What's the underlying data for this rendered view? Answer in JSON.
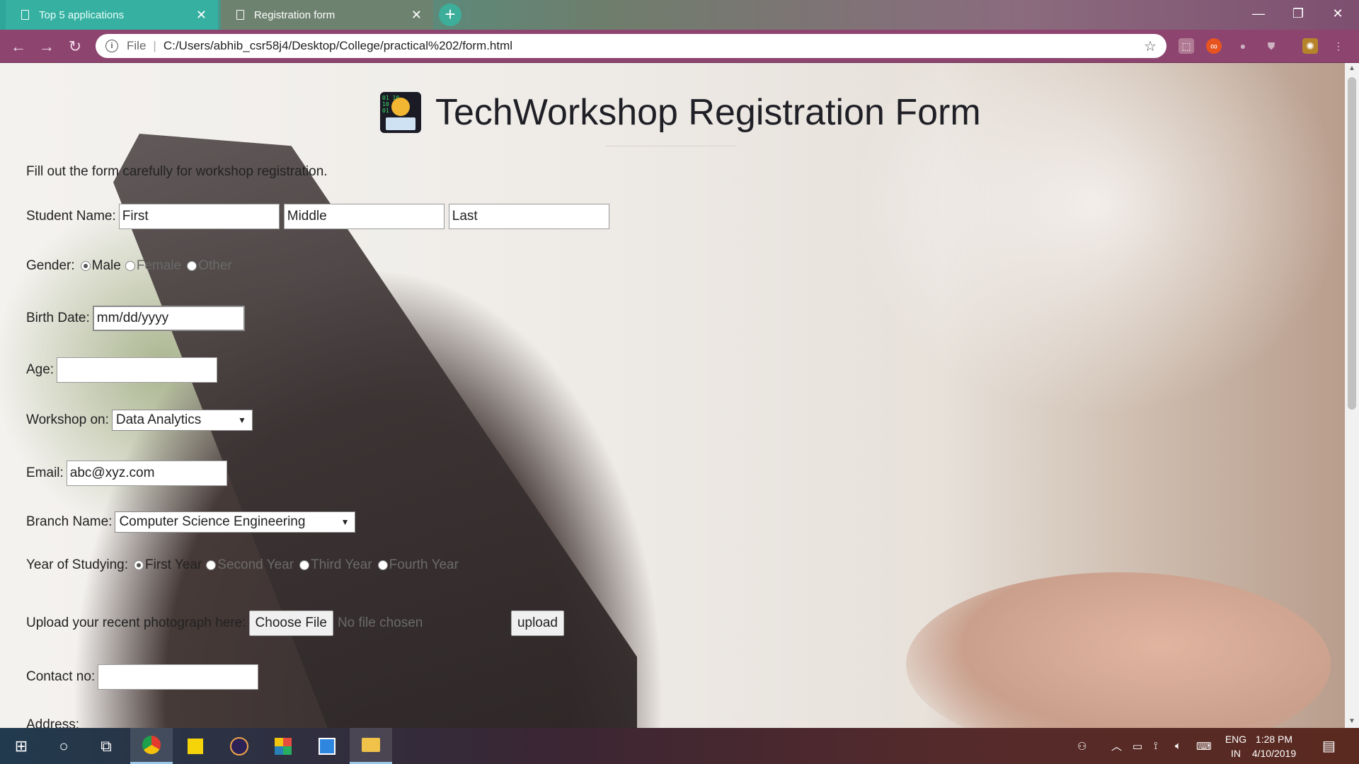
{
  "browser": {
    "tabs": [
      {
        "title": "Top 5 applications",
        "active": false
      },
      {
        "title": "Registration form",
        "active": true
      }
    ],
    "new_tab": "+",
    "address": {
      "scheme_label": "File",
      "separator": "|",
      "url": "C:/Users/abhib_csr58j4/Desktop/College/practical%202/form.html"
    },
    "window_controls": {
      "minimize": "—",
      "restore": "❐",
      "close": "✕"
    }
  },
  "form": {
    "title": "TechWorkshop Registration Form",
    "intro": "Fill out the form carefully for workshop registration.",
    "student_name": {
      "label": "Student Name:",
      "first_placeholder": "First",
      "middle_placeholder": "Middle",
      "last_placeholder": "Last"
    },
    "gender": {
      "label": "Gender:",
      "options": [
        "Male",
        "Female",
        "Other"
      ],
      "selected": "Male"
    },
    "birth_date": {
      "label": "Birth Date:",
      "placeholder": "mm/dd/yyyy"
    },
    "age": {
      "label": "Age:",
      "value": ""
    },
    "workshop": {
      "label": "Workshop on:",
      "selected": "Data Analytics"
    },
    "email": {
      "label": "Email:",
      "placeholder": "abc@xyz.com"
    },
    "branch": {
      "label": "Branch Name:",
      "selected": "Computer Science Engineering"
    },
    "year": {
      "label": "Year of Studying:",
      "options": [
        "First Year",
        "Second Year",
        "Third Year",
        "Fourth Year"
      ],
      "selected": "First Year"
    },
    "upload": {
      "label": "Upload your recent photograph here:",
      "choose_button": "Choose File",
      "file_status": "No file chosen",
      "upload_button": "upload"
    },
    "contact": {
      "label": "Contact no:",
      "value": ""
    },
    "address": {
      "label": "Address:"
    }
  },
  "taskbar": {
    "language": {
      "line1": "ENG",
      "line2": "IN"
    },
    "time": "1:28 PM",
    "date": "4/10/2019"
  },
  "colors": {
    "tab_active": "#6e8270",
    "tab_inactive": "#35b0a1",
    "addressbar": "#8d4570",
    "taskbar": "#3a2634"
  }
}
